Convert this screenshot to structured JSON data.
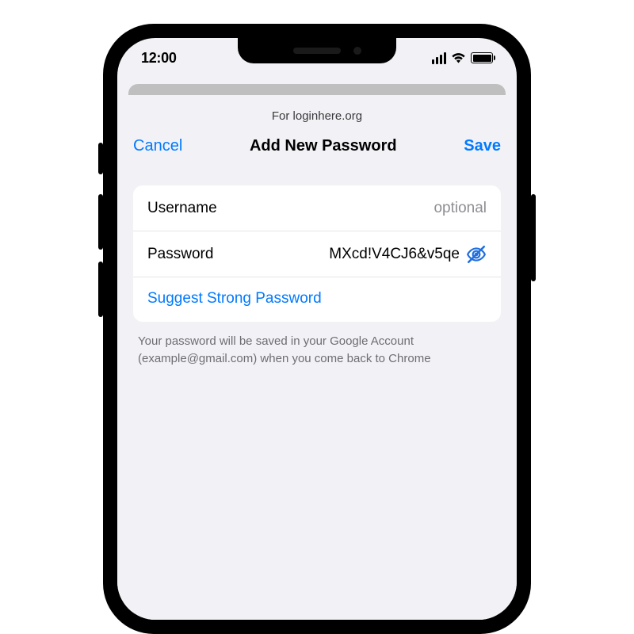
{
  "status": {
    "time": "12:00"
  },
  "sheet": {
    "subtitle": "For loginhere.org",
    "cancel_label": "Cancel",
    "title": "Add New Password",
    "save_label": "Save"
  },
  "fields": {
    "username": {
      "label": "Username",
      "value": "",
      "placeholder": "optional"
    },
    "password": {
      "label": "Password",
      "value": "MXcd!V4CJ6&v5qe"
    }
  },
  "suggest_label": "Suggest Strong Password",
  "footnote": "Your password will be saved in your Google Account (example@gmail.com) when you come back to Chrome",
  "colors": {
    "accent": "#007aff"
  }
}
